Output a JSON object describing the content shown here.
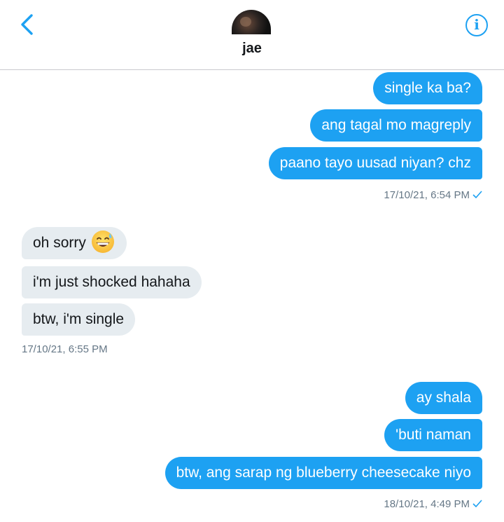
{
  "header": {
    "contact_name": "jae"
  },
  "messages": {
    "group1": [
      "single ka ba?",
      "ang tagal mo magreply",
      "paano tayo uusad niyan? chz"
    ],
    "group1_time": "17/10/21, 6:54 PM",
    "group2": [
      "oh sorry",
      "i'm just shocked hahaha",
      "btw, i'm single"
    ],
    "group2_time": "17/10/21, 6:55 PM",
    "group3": [
      "ay shala",
      "'buti naman",
      "btw, ang sarap ng blueberry cheesecake niyo"
    ],
    "group3_time": "18/10/21, 4:49 PM"
  },
  "colors": {
    "accent": "#1da1f2",
    "incoming_bubble": "#e6ecf0",
    "timestamp": "#657786"
  },
  "icons": {
    "back": "chevron-left-icon",
    "info": "info-icon",
    "read_receipt": "checkmark-icon",
    "emoji": "grinning-face-with-sweat-emoji"
  }
}
